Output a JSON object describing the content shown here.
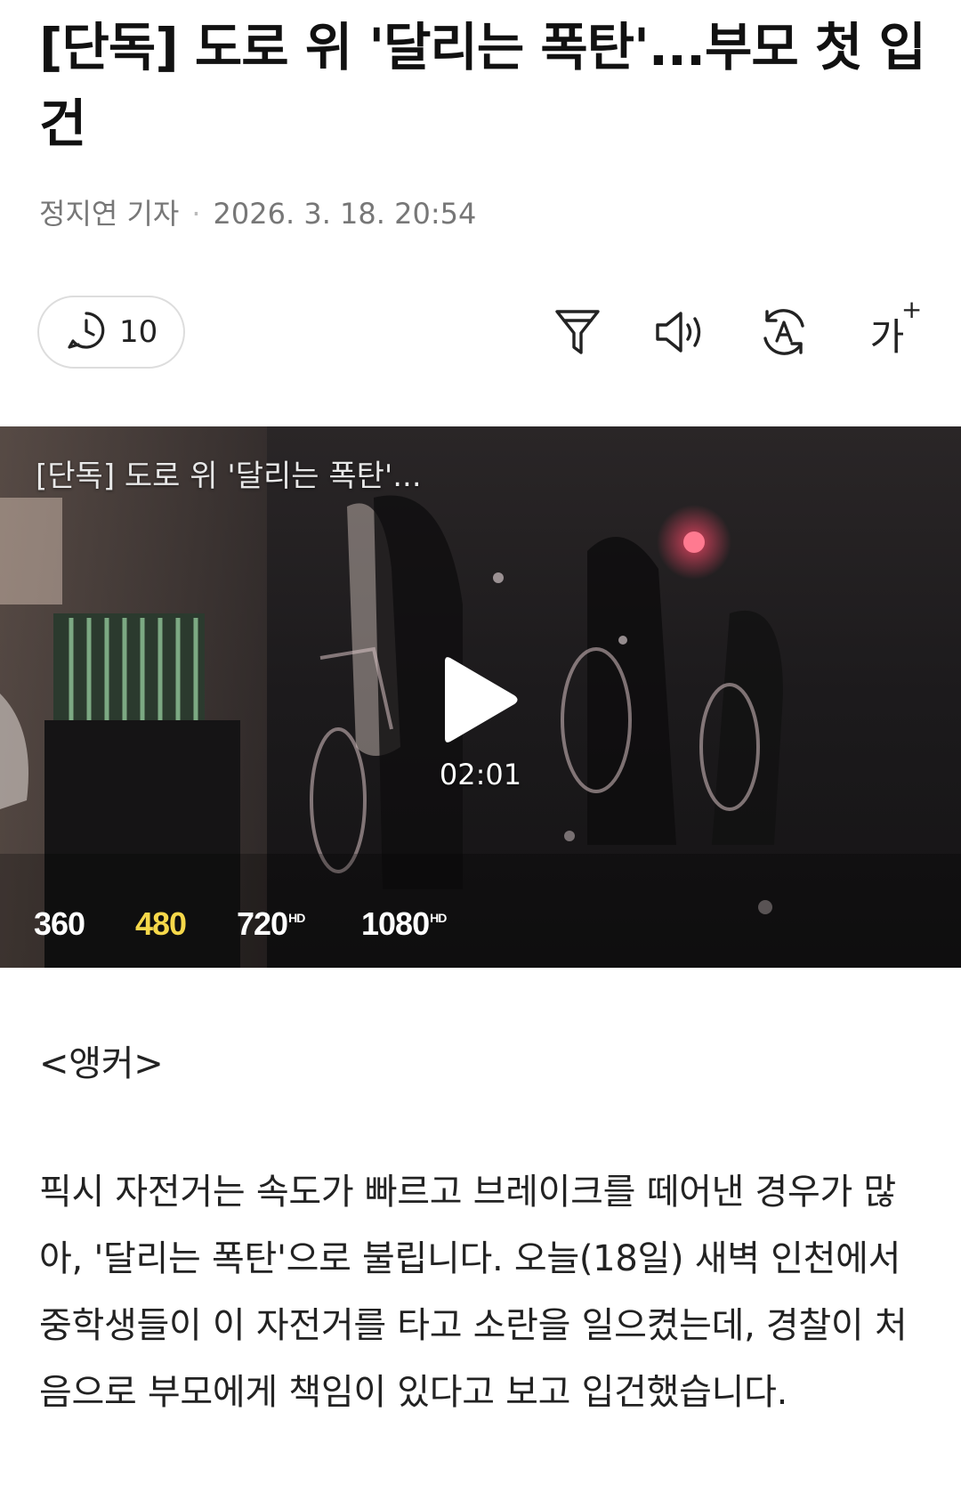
{
  "article": {
    "headline": "[단독] 도로 위 '달리는 폭탄'...부모 첫 입건",
    "reporter": "정지연 기자",
    "datetime": "2026. 3. 18. 20:54"
  },
  "toolbar": {
    "comment_count": "10",
    "icons": [
      "clock-comment-icon",
      "summary-filter-icon",
      "speaker-icon",
      "translate-icon",
      "font-size-icon"
    ],
    "font_size_label": "가",
    "font_size_plus": "+"
  },
  "video": {
    "title": "[단독] 도로 위 '달리는 폭탄'...",
    "duration": "02:01",
    "qualities": [
      {
        "label": "360",
        "hd": ""
      },
      {
        "label": "480",
        "hd": ""
      },
      {
        "label": "720",
        "hd": "HD"
      },
      {
        "label": "1080",
        "hd": "HD"
      }
    ],
    "selected_quality": "480",
    "active_color": "#f6d84a"
  },
  "body": {
    "anchor_label": "<앵커>",
    "paragraph": "픽시 자전거는 속도가 빠르고 브레이크를 떼어낸 경우가 많아, '달리는 폭탄'으로 불립니다. 오늘(18일) 새벽 인천에서 중학생들이 이 자전거를 타고 소란을 일으켰는데, 경찰이 처음으로 부모에게 책임이 있다고 보고 입건했습니다."
  }
}
